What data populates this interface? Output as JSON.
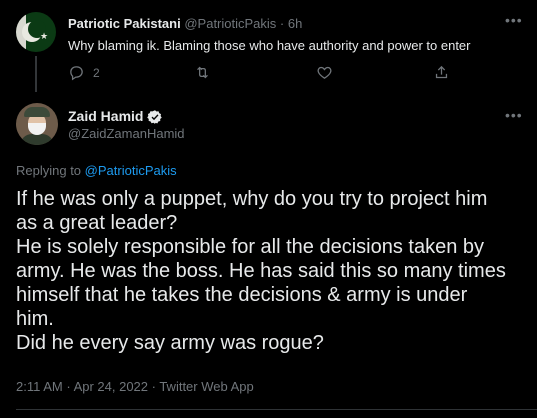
{
  "parent_tweet": {
    "display_name": "Patriotic Pakistani",
    "handle": "@PatrioticPakis",
    "separator": "·",
    "time": "6h",
    "text": "Why blaming ik. Blaming those who have authority and power to enter",
    "reply_count": "2",
    "more_icon": "more-icon"
  },
  "main_tweet": {
    "display_name": "Zaid Hamid",
    "handle": "@ZaidZamanHamid",
    "verified": true,
    "replying_prefix": "Replying to",
    "replying_to": "@PatrioticPakis",
    "text_lines": [
      "If he was only a puppet, why do you try to project him",
      "as a great leader?",
      "He is solely responsible for all the decisions taken by",
      "army. He was the boss. He has said this so many times",
      "himself that he takes the decisions & army is under",
      "him.",
      "Did he every say army was rogue?"
    ],
    "meta": "2:11 AM · Apr 24, 2022 · Twitter Web App"
  },
  "colors": {
    "background": "#000000",
    "text": "#e7e9ea",
    "muted": "#71767b",
    "accent": "#1d9bf0"
  }
}
